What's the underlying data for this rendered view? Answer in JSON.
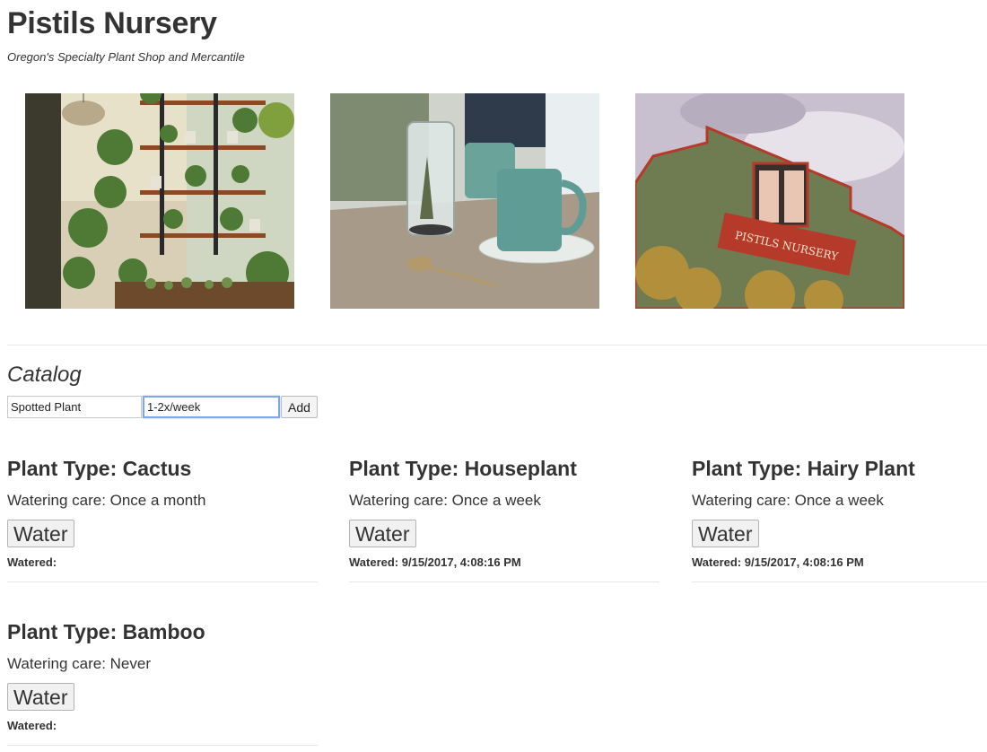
{
  "header": {
    "title": "Pistils Nursery",
    "tagline": "Oregon's Specialty Plant Shop and Mercantile",
    "sign_text": "PISTILS NURSERY"
  },
  "catalog": {
    "heading": "Catalog",
    "name_input_value": "Spotted Plant",
    "water_input_value": "1-2x/week",
    "add_label": "Add"
  },
  "plants": [
    {
      "type": "Plant Type: Cactus",
      "care": "Watering care: Once a month",
      "button_label": "Water",
      "watered": "Watered:"
    },
    {
      "type": "Plant Type: Houseplant",
      "care": "Watering care: Once a week",
      "button_label": "Water",
      "watered": "Watered: 9/15/2017, 4:08:16 PM"
    },
    {
      "type": "Plant Type: Hairy Plant",
      "care": "Watering care: Once a week",
      "button_label": "Water",
      "watered": "Watered: 9/15/2017, 4:08:16 PM"
    },
    {
      "type": "Plant Type: Bamboo",
      "care": "Watering care: Never",
      "button_label": "Water",
      "watered": "Watered:"
    }
  ],
  "colors": {
    "text": "#333333",
    "divider": "#e6e6e6",
    "input_focus": "#7fa7e6"
  }
}
